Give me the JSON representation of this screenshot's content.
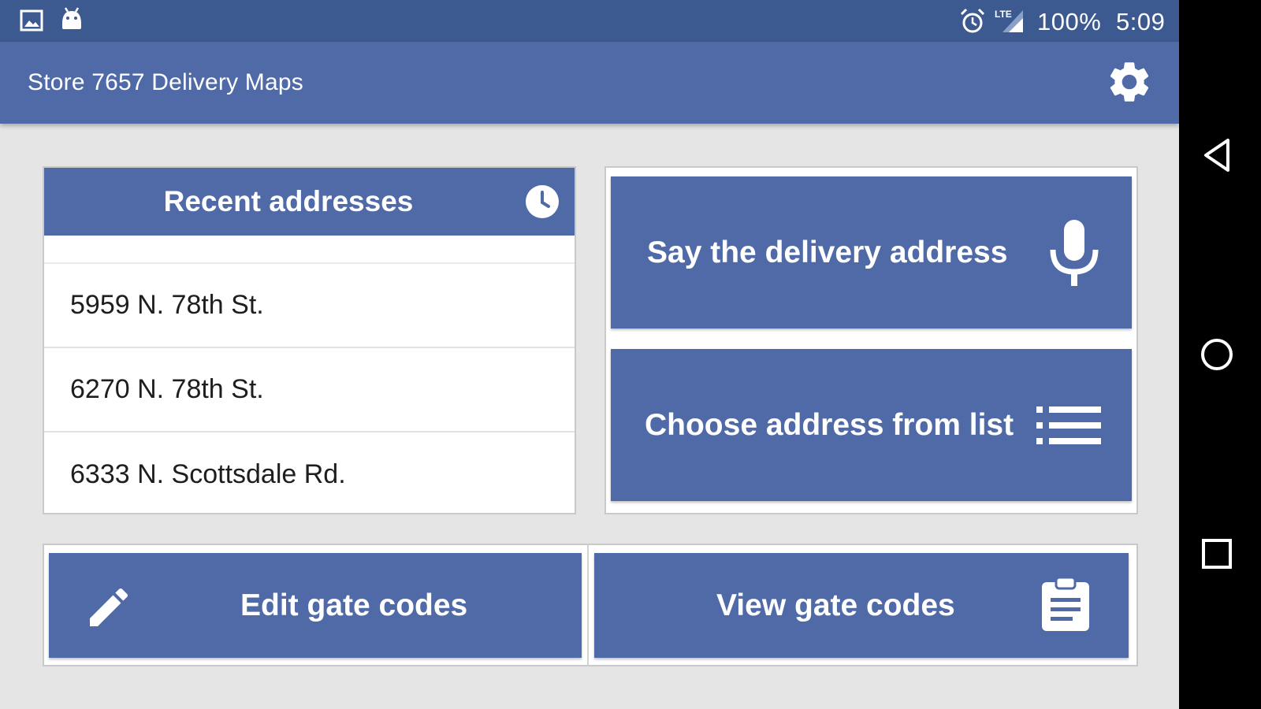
{
  "status_bar": {
    "icons": [
      "image-icon",
      "android-icon",
      "alarm-icon",
      "lte-signal-icon"
    ],
    "network_label": "LTE",
    "battery": "100%",
    "time": "5:09"
  },
  "app_bar": {
    "title": "Store 7657 Delivery Maps",
    "settings_icon": "gear-icon"
  },
  "recent": {
    "title": "Recent addresses",
    "icon": "clock-icon",
    "items": [
      "5959 N. 78th St.",
      "6270 N. 78th St.",
      "6333 N. Scottsdale Rd."
    ]
  },
  "actions": {
    "say_address": {
      "label": "Say the delivery address",
      "icon": "microphone-icon"
    },
    "choose_address": {
      "label": "Choose address from list",
      "icon": "list-icon"
    }
  },
  "gate_codes": {
    "edit": {
      "label": "Edit gate codes",
      "icon": "pencil-icon"
    },
    "view": {
      "label": "View gate codes",
      "icon": "clipboard-icon"
    }
  },
  "nav_bar": {
    "buttons": [
      "back-triangle-icon",
      "home-circle-icon",
      "recents-square-icon"
    ]
  },
  "colors": {
    "primary": "#506aa8",
    "status_bar": "#3c5990",
    "background": "#e5e5e5"
  }
}
